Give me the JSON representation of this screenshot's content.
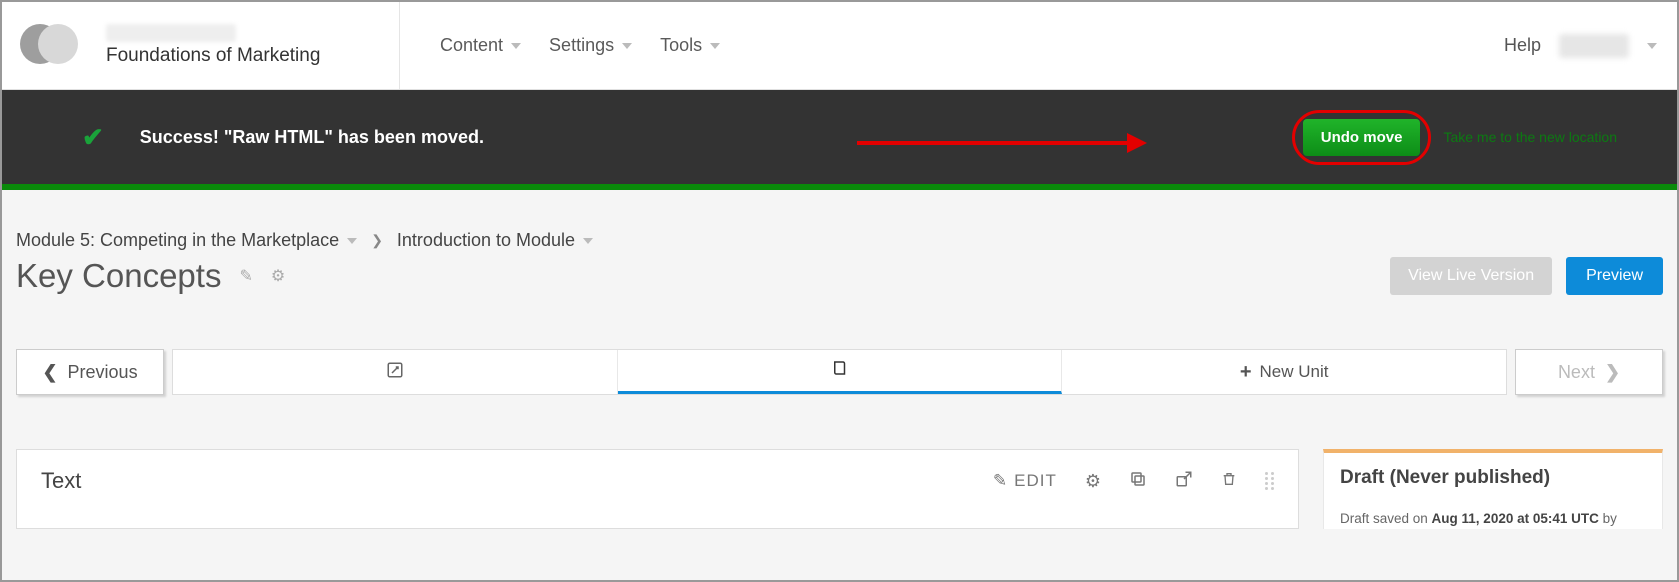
{
  "header": {
    "course_name": "Foundations of Marketing",
    "nav": {
      "content": "Content",
      "settings": "Settings",
      "tools": "Tools"
    },
    "help": "Help"
  },
  "notif": {
    "message": "Success! \"Raw HTML\" has been moved.",
    "undo_label": "Undo move",
    "take_me_label": "Take me to the new location"
  },
  "breadcrumb": {
    "module": "Module 5: Competing in the Marketplace",
    "intro": "Introduction to Module"
  },
  "page": {
    "title": "Key Concepts",
    "view_live": "View Live Version",
    "preview": "Preview"
  },
  "pager": {
    "previous": "Previous",
    "new_unit": "New Unit",
    "next": "Next"
  },
  "editor": {
    "block_title": "Text",
    "edit_label": "EDIT"
  },
  "draft": {
    "title": "Draft (Never published)",
    "saved_prefix": "Draft saved on ",
    "saved_date": "Aug 11, 2020 at 05:41 UTC",
    "saved_suffix": " by"
  }
}
